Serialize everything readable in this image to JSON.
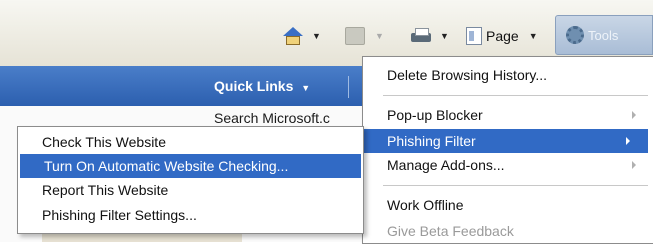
{
  "toolbar": {
    "icons": [
      "home-icon",
      "feed-icon",
      "print-icon",
      "page-icon",
      "gear-icon"
    ],
    "page_label": "Page",
    "tools_label": "Tools"
  },
  "links_bar": {
    "quick_links_label": "Quick Links",
    "search_text": "Search Microsoft.c"
  },
  "tools_menu": {
    "items": [
      {
        "label": "Delete Browsing History..."
      },
      {
        "label": "Pop-up Blocker"
      },
      {
        "label": "Phishing Filter"
      },
      {
        "label": "Manage Add-ons..."
      },
      {
        "label": "Work Offline"
      },
      {
        "label": "Give Beta Feedback"
      }
    ]
  },
  "phishing_submenu": {
    "items": [
      {
        "label": "Check This Website"
      },
      {
        "label": "Turn On Automatic Website Checking..."
      },
      {
        "label": "Report This Website"
      },
      {
        "label": "Phishing Filter Settings..."
      }
    ]
  },
  "colors": {
    "highlight": "#316ac5",
    "links_bar": "#2c5faf",
    "command_bar": "#ece9d8"
  }
}
